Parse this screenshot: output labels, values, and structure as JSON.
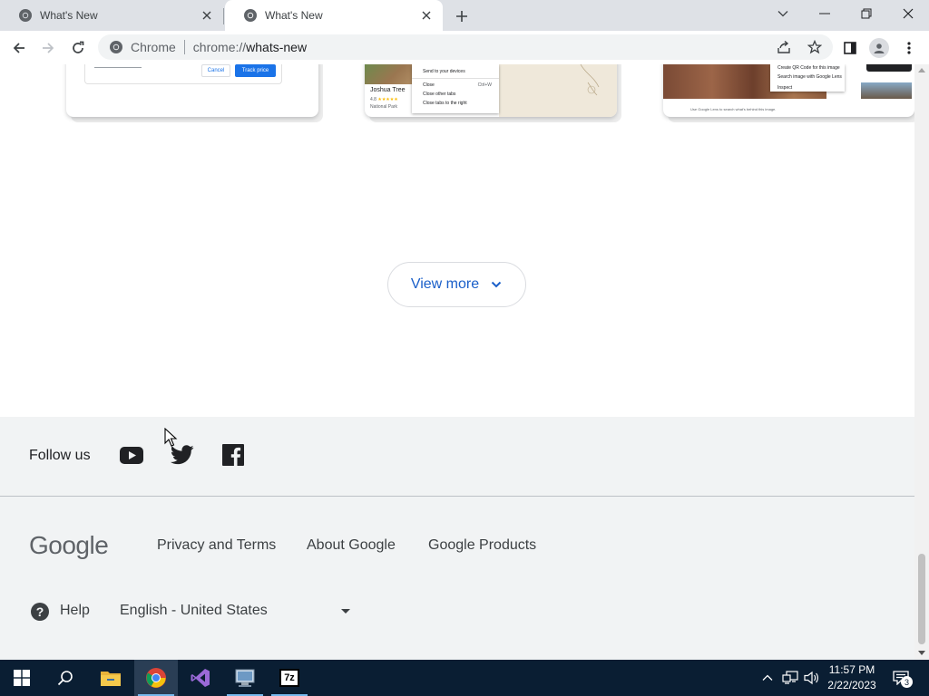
{
  "browser": {
    "tabs": [
      {
        "title": "What's New",
        "active": false
      },
      {
        "title": "What's New",
        "active": true
      }
    ],
    "omnibox": {
      "site_label": "Chrome",
      "url_scheme": "chrome://",
      "url_host": "whats-new"
    }
  },
  "page": {
    "cards": {
      "card1": {
        "cancel_label": "Cancel",
        "track_label": "Track price"
      },
      "card2": {
        "place_name": "Joshua Tree",
        "rating": "4.8",
        "stars": "★★★★★",
        "place_type": "National Park",
        "menu_items": [
          {
            "label": "Send to your devices",
            "shortcut": ""
          },
          {
            "label": "Close",
            "shortcut": "Ctrl+W"
          },
          {
            "label": "Close other tabs",
            "shortcut": ""
          },
          {
            "label": "Close tabs to the right",
            "shortcut": ""
          }
        ]
      },
      "card3": {
        "menu_items": [
          "Create QR Code for this image",
          "Search image with Google Lens",
          "Inspect"
        ],
        "caption": "Use Google Lens to search what's behind this image."
      }
    },
    "view_more_label": "View more",
    "footer": {
      "follow_label": "Follow us",
      "social": [
        "youtube-icon",
        "twitter-icon",
        "facebook-icon"
      ],
      "logo_text": "Google",
      "links": [
        "Privacy and Terms",
        "About Google",
        "Google Products"
      ],
      "help_label": "Help",
      "language": "English - United States"
    }
  },
  "taskbar": {
    "apps": [
      "start-icon",
      "search-icon",
      "file-explorer-icon",
      "chrome-icon",
      "visual-studio-icon",
      "control-panel-icon",
      "7zip-icon"
    ],
    "seven_zip_label": "7z",
    "time": "11:57 PM",
    "date": "2/22/2023",
    "notification_count": "3"
  },
  "colors": {
    "accent": "#1a5fc9",
    "footer_bg": "#f1f3f4",
    "taskbar_bg": "#0a1e33",
    "tabstrip_bg": "#dee1e6"
  }
}
